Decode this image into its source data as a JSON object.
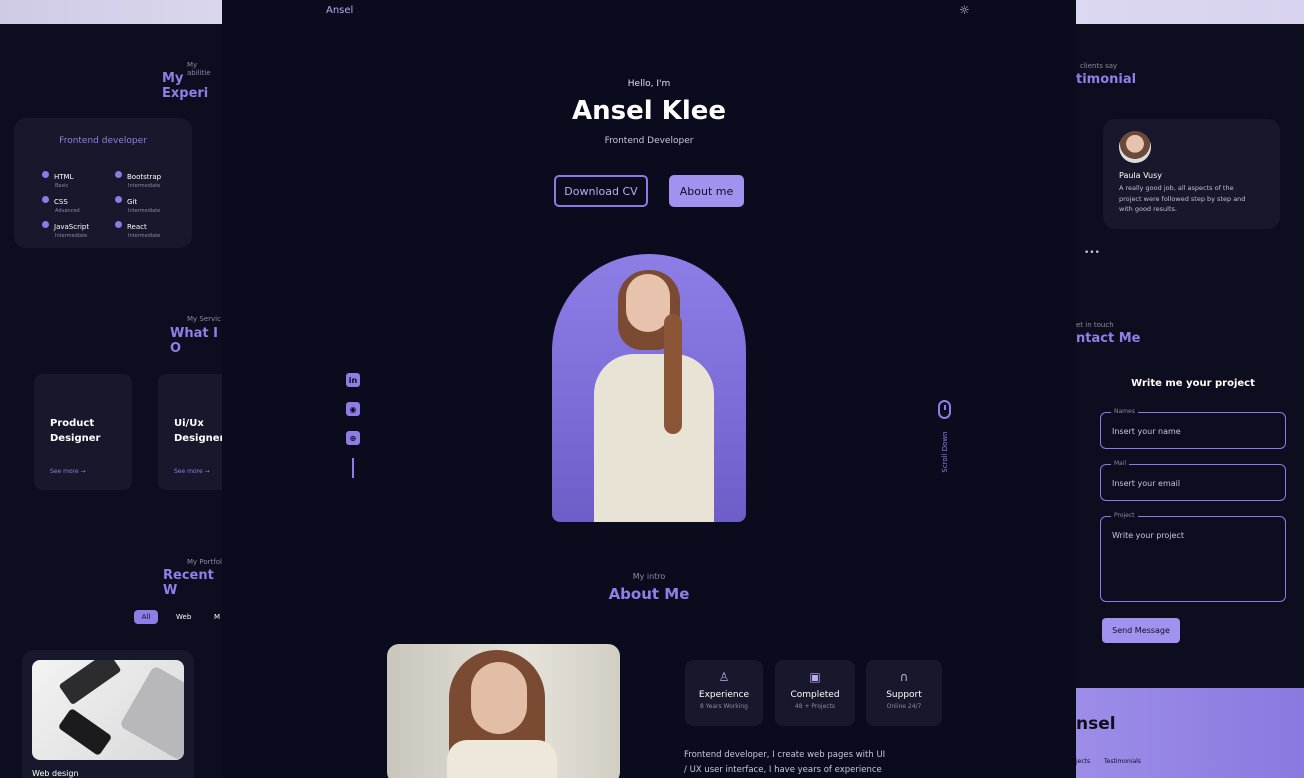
{
  "brand": "Ansel",
  "hero": {
    "greeting": "Hello, I'm",
    "name": "Ansel Klee",
    "role": "Frontend Developer",
    "download_btn": "Download CV",
    "about_btn": "About me",
    "scroll": "Scroll Down"
  },
  "experience": {
    "sub": "My abilitie",
    "title": "My Experi",
    "card_title": "Frontend developer",
    "skills": [
      {
        "name": "HTML",
        "level": "Basic"
      },
      {
        "name": "Bootstrap",
        "level": "Intermediate"
      },
      {
        "name": "CSS",
        "level": "Advanced"
      },
      {
        "name": "Git",
        "level": "Intermediate"
      },
      {
        "name": "JavaScript",
        "level": "Intermediate"
      },
      {
        "name": "React",
        "level": "Intermediate"
      }
    ]
  },
  "services": {
    "sub": "My Servic",
    "title": "What I O",
    "items": [
      {
        "line1": "Product",
        "line2": "Designer",
        "more": "See more →"
      },
      {
        "line1": "Ui/Ux",
        "line2": "Designer",
        "more": "See more →"
      }
    ]
  },
  "portfolio": {
    "sub": "My Portfol",
    "title": "Recent W",
    "filters": [
      "All",
      "Web",
      "M"
    ],
    "card_caption": "Web design"
  },
  "about": {
    "sub": "My intro",
    "title": "About Me",
    "stats": [
      {
        "icon": "award-icon",
        "title": "Experience",
        "sub": "8 Years Working"
      },
      {
        "icon": "briefcase-icon",
        "title": "Completed",
        "sub": "48 + Projects"
      },
      {
        "icon": "headset-icon",
        "title": "Support",
        "sub": "Online 24/7"
      }
    ],
    "desc1": "Frontend developer, I create web pages with UI",
    "desc2": "/ UX user interface, I have years of experience"
  },
  "testimonial": {
    "sub": "clients say",
    "title": "timonial",
    "name": "Paula Vusy",
    "text1": "A really good job, all aspects of the",
    "text2": "project were followed step by step and",
    "text3": "with good results.",
    "dots": "•••"
  },
  "contact": {
    "sub": "et in touch",
    "title": "ntact Me",
    "form_title": "Write me your project",
    "fields": [
      {
        "label": "Names",
        "placeholder": "Insert your name"
      },
      {
        "label": "Mail",
        "placeholder": "Insert your email"
      },
      {
        "label": "Project",
        "placeholder": "Write your project"
      }
    ],
    "send": "Send Message"
  },
  "footer": {
    "brand": "nsel",
    "link1": "jects",
    "link2": "Testimonials"
  },
  "colors": {
    "accent": "#8d7ee6",
    "bg": "#0a0b1d",
    "card": "#17182b"
  }
}
